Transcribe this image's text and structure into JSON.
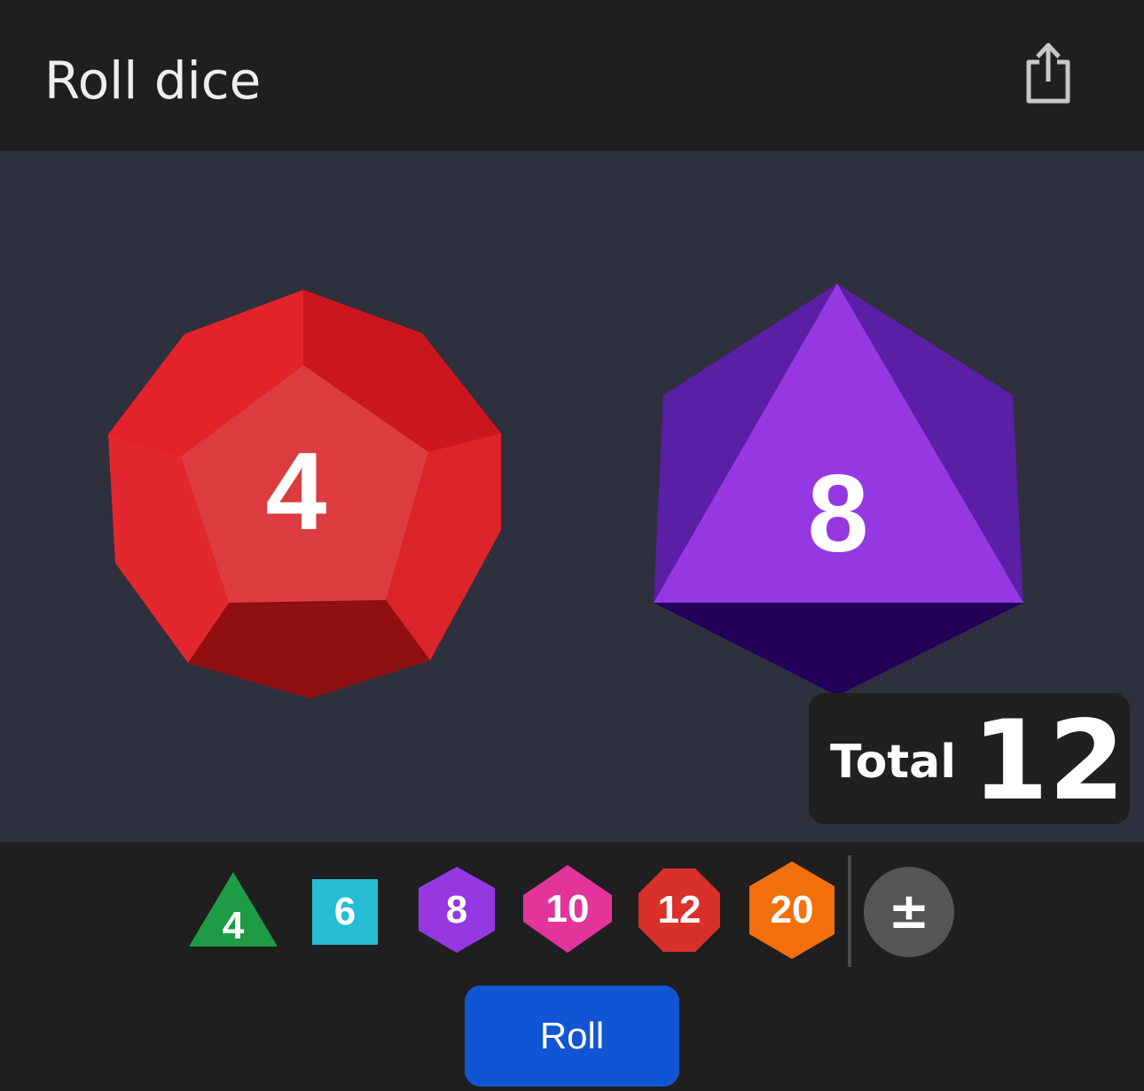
{
  "header": {
    "title": "Roll dice",
    "share_icon": "share-icon"
  },
  "results": [
    {
      "die": "d12",
      "value": "4",
      "color": "#e0242b"
    },
    {
      "die": "d8",
      "value": "8",
      "color": "#9538e2"
    }
  ],
  "total": {
    "label": "Total",
    "value": "12"
  },
  "dice_buttons": [
    {
      "sides": "4",
      "color": "#1f9a45"
    },
    {
      "sides": "6",
      "color": "#26bcd4"
    },
    {
      "sides": "8",
      "color": "#9538e2"
    },
    {
      "sides": "10",
      "color": "#e2349a"
    },
    {
      "sides": "12",
      "color": "#d9302c"
    },
    {
      "sides": "20",
      "color": "#f2700c"
    }
  ],
  "modifier": {
    "label": "±"
  },
  "roll_button": {
    "label": "Roll",
    "color": "#1155d4"
  }
}
